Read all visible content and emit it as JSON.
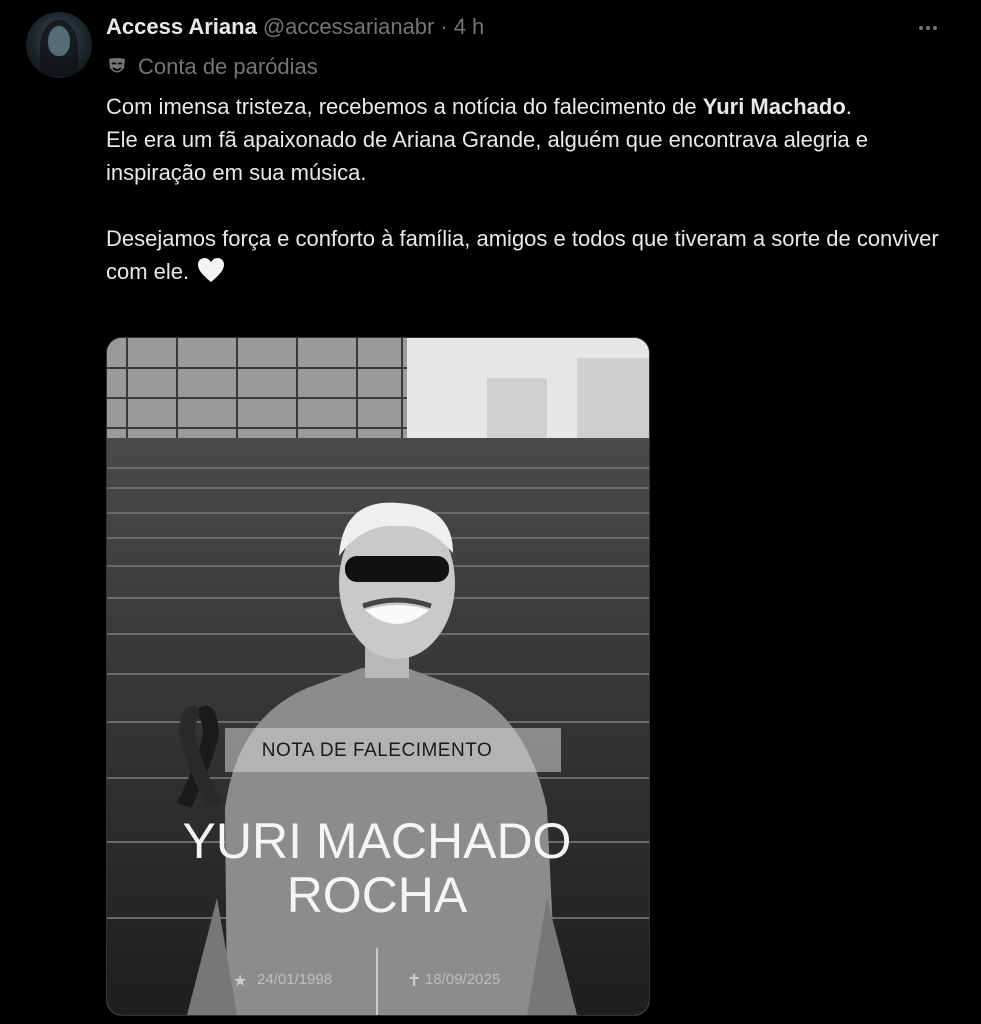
{
  "tweet": {
    "author_name": "Access Ariana",
    "handle": "@accessarianabr",
    "separator": "·",
    "time": "4 h",
    "parody_label": "Conta de paródias",
    "parody_icon": "theater-mask-icon",
    "more_icon": "more-dots-icon",
    "text": {
      "line1_prefix": "Com imensa tristeza, recebemos a notícia do falecimento de ",
      "line1_bold": "Yuri Machado",
      "line1_suffix": ".",
      "line2": "Ele era um fã apaixonado de Ariana Grande, alguém que encontrava alegria e inspiração em sua música.",
      "line3": "Desejamos força e conforto à família, amigos e todos que tiveram a sorte de conviver com ele.",
      "heart_icon": "white-heart-icon"
    },
    "media": {
      "banner": "NOTA DE FALECIMENTO",
      "name_line1": "YURI MACHADO",
      "name_line2": "ROCHA",
      "birth": "24/01/1998",
      "death": "18/09/2025",
      "ribbon_icon": "mourning-ribbon-icon",
      "star_icon": "star-icon",
      "cross_icon": "cross-icon"
    }
  },
  "colors": {
    "background": "#000000",
    "text_primary": "#e7e9ea",
    "text_secondary": "#71767b",
    "border": "#2f3336"
  }
}
